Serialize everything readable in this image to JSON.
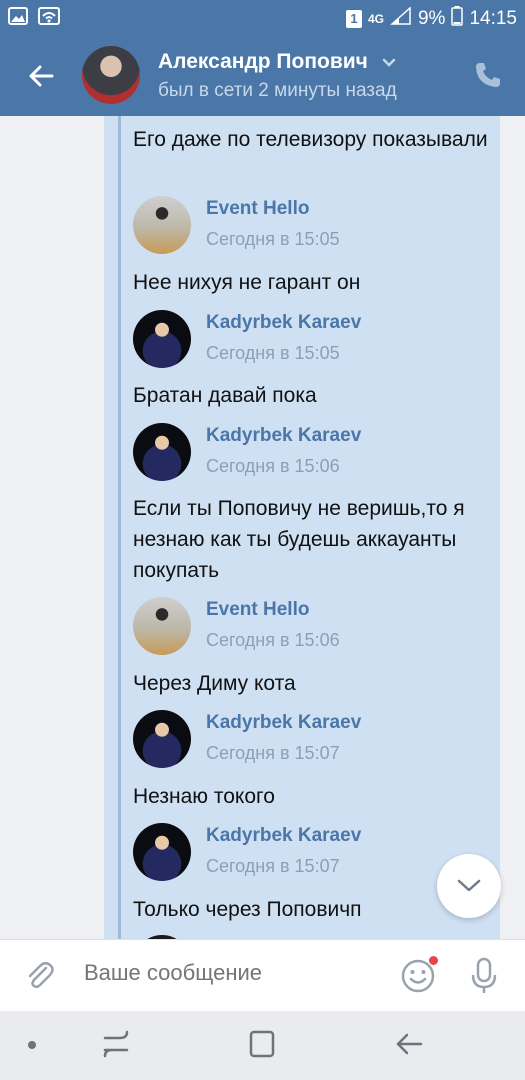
{
  "status_bar": {
    "left_icons": [
      "image-icon",
      "wifi-icon"
    ],
    "sim_badge": "1",
    "network": "4G",
    "battery_percent": "9%",
    "time": "14:15"
  },
  "header": {
    "contact_name": "Александр Попович",
    "presence": "был в сети 2 минуты назад"
  },
  "messages": [
    {
      "type": "text",
      "text": "Его даже по телевизору показывали"
    },
    {
      "type": "forward",
      "author": "Event Hello",
      "time": "Сегодня в 15:05"
    },
    {
      "type": "text",
      "text": "Нее нихуя не гарант он"
    },
    {
      "type": "forward",
      "author": "Kadyrbek Karaev",
      "time": "Сегодня в 15:05"
    },
    {
      "type": "text",
      "text": "Братан давай пока"
    },
    {
      "type": "forward",
      "author": "Kadyrbek Karaev",
      "time": "Сегодня в 15:06"
    },
    {
      "type": "text",
      "text": "Если ты Поповичу не веришь,то я незнаю как ты будешь аккауанты покупать"
    },
    {
      "type": "forward",
      "author": "Event Hello",
      "time": "Сегодня в 15:06"
    },
    {
      "type": "text",
      "text": "Через Диму кота"
    },
    {
      "type": "forward",
      "author": "Kadyrbek Karaev",
      "time": "Сегодня в 15:07"
    },
    {
      "type": "text",
      "text": "Незнаю токого"
    },
    {
      "type": "forward",
      "author": "Kadyrbek Karaev",
      "time": "Сегодня в 15:07"
    },
    {
      "type": "text",
      "text": "Только через Поповичп"
    }
  ],
  "composer": {
    "placeholder": "Ваше сообщение"
  },
  "colors": {
    "brand": "#4a76a8",
    "bubble": "#cfe0f3",
    "link": "#4a76a8"
  }
}
